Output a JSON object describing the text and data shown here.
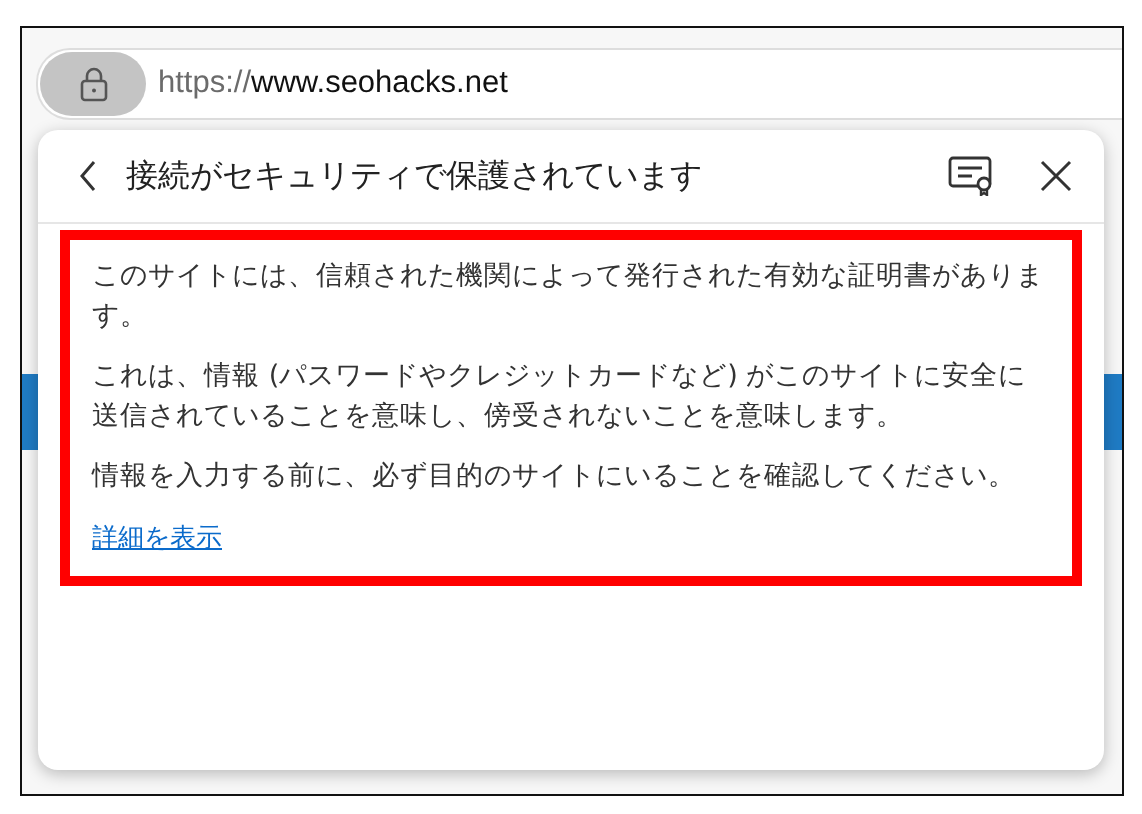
{
  "address_bar": {
    "scheme": "https://",
    "host": "www.seohacks.net"
  },
  "popup": {
    "title": "接続がセキュリティで保護されています",
    "paragraphs": [
      "このサイトには、信頼された機関によって発行された有効な証明書があります。",
      "これは、情報 (パスワードやクレジットカードなど) がこのサイトに安全に送信されていることを意味し、傍受されないことを意味します。",
      "情報を入力する前に、必ず目的のサイトにいることを確認してください。"
    ],
    "link": "詳細を表示"
  }
}
